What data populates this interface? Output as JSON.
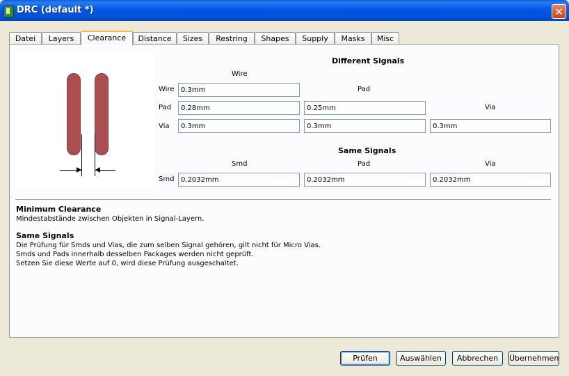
{
  "window": {
    "title": "DRC (default *)"
  },
  "tabs": [
    "Datei",
    "Layers",
    "Clearance",
    "Distance",
    "Sizes",
    "Restring",
    "Shapes",
    "Supply",
    "Masks",
    "Misc"
  ],
  "active_tab": "Clearance",
  "different_signals": {
    "header": "Different Signals",
    "col_wire": "Wire",
    "col_pad": "Pad",
    "col_via": "Via",
    "row_wire": "Wire",
    "row_pad": "Pad",
    "row_via": "Via",
    "wire_wire": "0.3mm",
    "pad_wire": "0.28mm",
    "pad_pad": "0.25mm",
    "via_wire": "0.3mm",
    "via_pad": "0.3mm",
    "via_via": "0.3mm"
  },
  "same_signals": {
    "header": "Same Signals",
    "col_smd": "Smd",
    "col_pad": "Pad",
    "col_via": "Via",
    "row_smd": "Smd",
    "smd_smd": "0.2032mm",
    "smd_pad": "0.2032mm",
    "smd_via": "0.2032mm"
  },
  "description": {
    "min_title": "Minimum Clearance",
    "min_text": "Mindestabstände zwischen Objekten in Signal-Layern.",
    "same_title": "Same Signals",
    "same_line1": "Die Prüfung für Smds und Vias, die zum selben Signal gehören, gilt nicht für Micro Vias.",
    "same_line2": "Smds und Pads innerhalb desselben Packages werden nicht geprüft.",
    "same_line3": "Setzen Sie diese Werte auf 0, wird diese Prüfung ausgeschaltet."
  },
  "buttons": {
    "check": "Prüfen",
    "select": "Auswählen",
    "cancel": "Abbrechen",
    "apply": "Übernehmen"
  }
}
